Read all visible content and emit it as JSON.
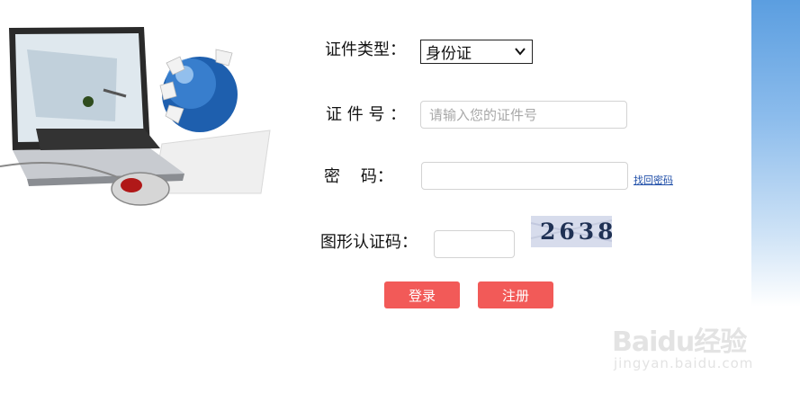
{
  "form": {
    "id_type_label": "证件类型：",
    "id_type_selected": "身份证",
    "id_number_label": "证 件 号 ：",
    "id_number_placeholder": "请输入您的证件号",
    "password_label": "密    码：",
    "forgot_password_link": "找回密码",
    "captcha_label": "图形认证码：",
    "captcha_code": "2638",
    "login_button": "登录",
    "register_button": "注册"
  },
  "watermark": {
    "brand": "Baidu经验",
    "url": "jingyan.baidu.com"
  },
  "colors": {
    "button_bg": "#f25a58",
    "link": "#1f4ea8",
    "side_strip": "#5b9ee0"
  },
  "icons": {
    "illustration": "laptop-globe-illustration",
    "dropdown": "chevron-down-icon"
  }
}
